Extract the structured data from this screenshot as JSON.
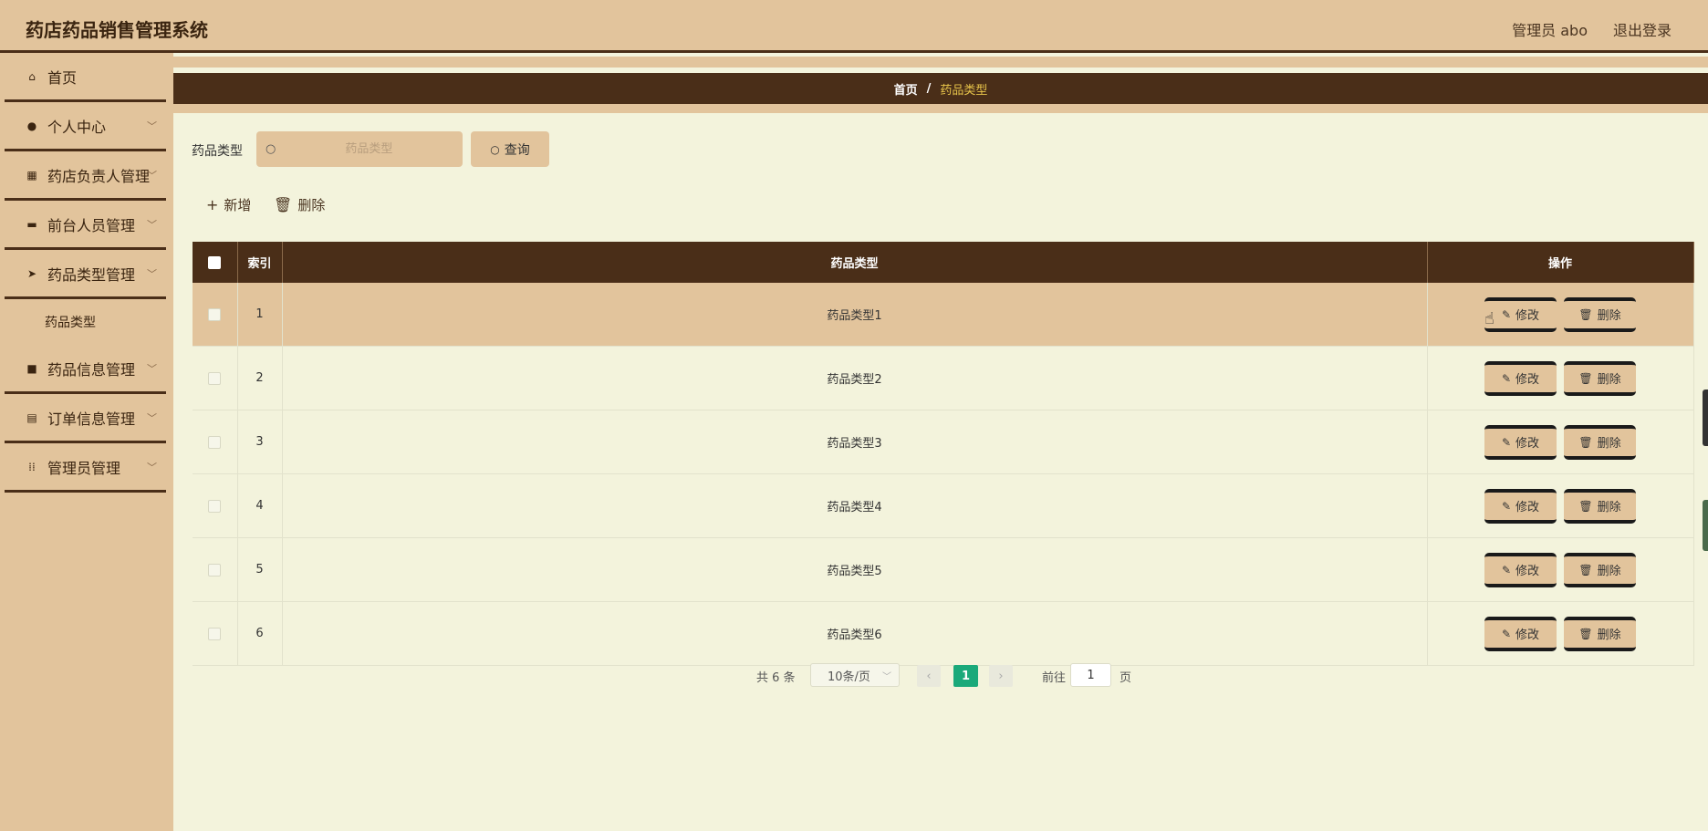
{
  "header": {
    "title": "药店药品销售管理系统",
    "user_label": "管理员 abo",
    "logout_label": "退出登录"
  },
  "sidebar": {
    "items": [
      {
        "label": "首页",
        "icon": "home-icon",
        "has_chevron": false
      },
      {
        "label": "个人中心",
        "icon": "user-icon",
        "has_chevron": true
      },
      {
        "label": "药店负责人管理",
        "icon": "grid-icon",
        "has_chevron": true
      },
      {
        "label": "前台人员管理",
        "icon": "monitor-icon",
        "has_chevron": true
      },
      {
        "label": "药品类型管理",
        "icon": "send-icon",
        "has_chevron": true
      },
      {
        "label": "药品信息管理",
        "icon": "briefcase-icon",
        "has_chevron": true
      },
      {
        "label": "订单信息管理",
        "icon": "clipboard-icon",
        "has_chevron": true
      },
      {
        "label": "管理员管理",
        "icon": "apps-icon",
        "has_chevron": true
      }
    ],
    "sub_item": "药品类型"
  },
  "breadcrumb": {
    "home": "首页",
    "separator": "/",
    "current": "药品类型"
  },
  "search": {
    "label": "药品类型",
    "placeholder": "药品类型",
    "value": "",
    "button_label": "查询"
  },
  "actions": {
    "add_label": "新增",
    "delete_label": "删除"
  },
  "table": {
    "columns": [
      "索引",
      "药品类型",
      "操作"
    ],
    "rows": [
      {
        "index": "1",
        "type": "药品类型1"
      },
      {
        "index": "2",
        "type": "药品类型2"
      },
      {
        "index": "3",
        "type": "药品类型3"
      },
      {
        "index": "4",
        "type": "药品类型4"
      },
      {
        "index": "5",
        "type": "药品类型5"
      },
      {
        "index": "6",
        "type": "药品类型6"
      }
    ],
    "edit_label": "修改",
    "delete_label": "删除"
  },
  "pagination": {
    "total_text": "共 6 条",
    "page_size": "10条/页",
    "current_page": "1",
    "goto_label": "前往",
    "goto_value": "1",
    "page_suffix": "页"
  },
  "colors": {
    "accent": "#e2c49c",
    "dark": "#4a2e18",
    "background": "#f3f3dc",
    "page_active": "#1aa97a",
    "crumb_current": "#e8c44a"
  }
}
